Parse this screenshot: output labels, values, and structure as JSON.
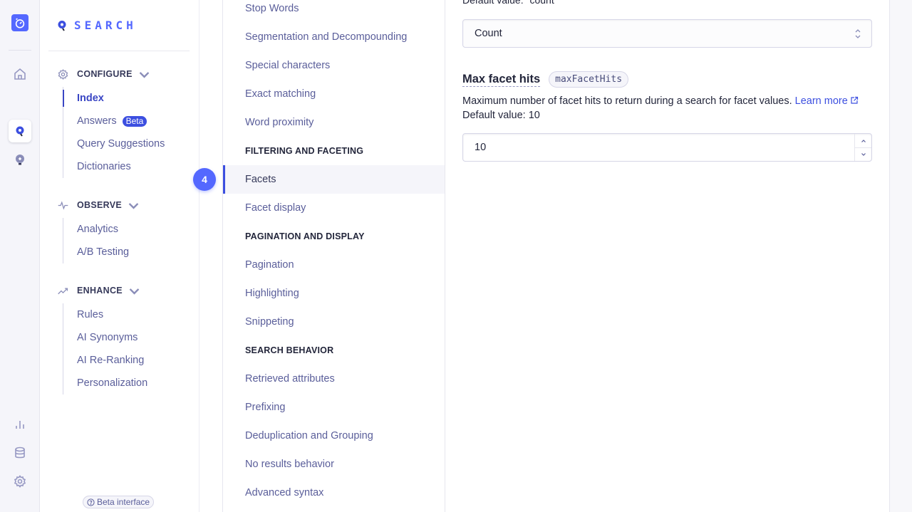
{
  "rail": {
    "icons": [
      "stopwatch-logo",
      "home-icon",
      "search-icon",
      "recommend-bulb-icon",
      "analytics-bar-icon",
      "database-icon",
      "settings-gear-icon"
    ],
    "active": "search-icon",
    "accent": "#5468ff"
  },
  "sidebar": {
    "brand": "SEARCH",
    "groups": [
      {
        "title": "CONFIGURE",
        "icon": "gear-icon",
        "items": [
          {
            "label": "Index",
            "active": true
          },
          {
            "label": "Answers",
            "badge": "Beta"
          },
          {
            "label": "Query Suggestions"
          },
          {
            "label": "Dictionaries"
          }
        ]
      },
      {
        "title": "OBSERVE",
        "icon": "pulse-icon",
        "items": [
          {
            "label": "Analytics"
          },
          {
            "label": "A/B Testing"
          }
        ]
      },
      {
        "title": "ENHANCE",
        "icon": "trending-up-icon",
        "items": [
          {
            "label": "Rules"
          },
          {
            "label": "AI Synonyms"
          },
          {
            "label": "AI Re-Ranking"
          },
          {
            "label": "Personalization"
          }
        ]
      }
    ],
    "beta_interface": "Beta interface"
  },
  "nav": {
    "step_number": "4",
    "entries": [
      {
        "type": "item",
        "label": "Stop Words"
      },
      {
        "type": "item",
        "label": "Segmentation and Decompounding"
      },
      {
        "type": "item",
        "label": "Special characters"
      },
      {
        "type": "item",
        "label": "Exact matching"
      },
      {
        "type": "item",
        "label": "Word proximity"
      },
      {
        "type": "section",
        "label": "FILTERING AND FACETING"
      },
      {
        "type": "item",
        "label": "Facets",
        "active": true
      },
      {
        "type": "item",
        "label": "Facet display"
      },
      {
        "type": "section",
        "label": "PAGINATION AND DISPLAY"
      },
      {
        "type": "item",
        "label": "Pagination"
      },
      {
        "type": "item",
        "label": "Highlighting"
      },
      {
        "type": "item",
        "label": "Snippeting"
      },
      {
        "type": "section",
        "label": "SEARCH BEHAVIOR"
      },
      {
        "type": "item",
        "label": "Retrieved attributes"
      },
      {
        "type": "item",
        "label": "Prefixing"
      },
      {
        "type": "item",
        "label": "Deduplication and Grouping"
      },
      {
        "type": "item",
        "label": "No results behavior"
      },
      {
        "type": "item",
        "label": "Advanced syntax"
      }
    ]
  },
  "content": {
    "sort_default_text": "Default value: \"count\"",
    "sort_select_value": "Count",
    "max_facet_hits": {
      "label": "Max facet hits",
      "param": "maxFacetHits",
      "description": "Maximum number of facet hits to return during a search for facet values.",
      "learn_more": "Learn more",
      "default_text": "Default value: 10",
      "value": "10"
    }
  }
}
